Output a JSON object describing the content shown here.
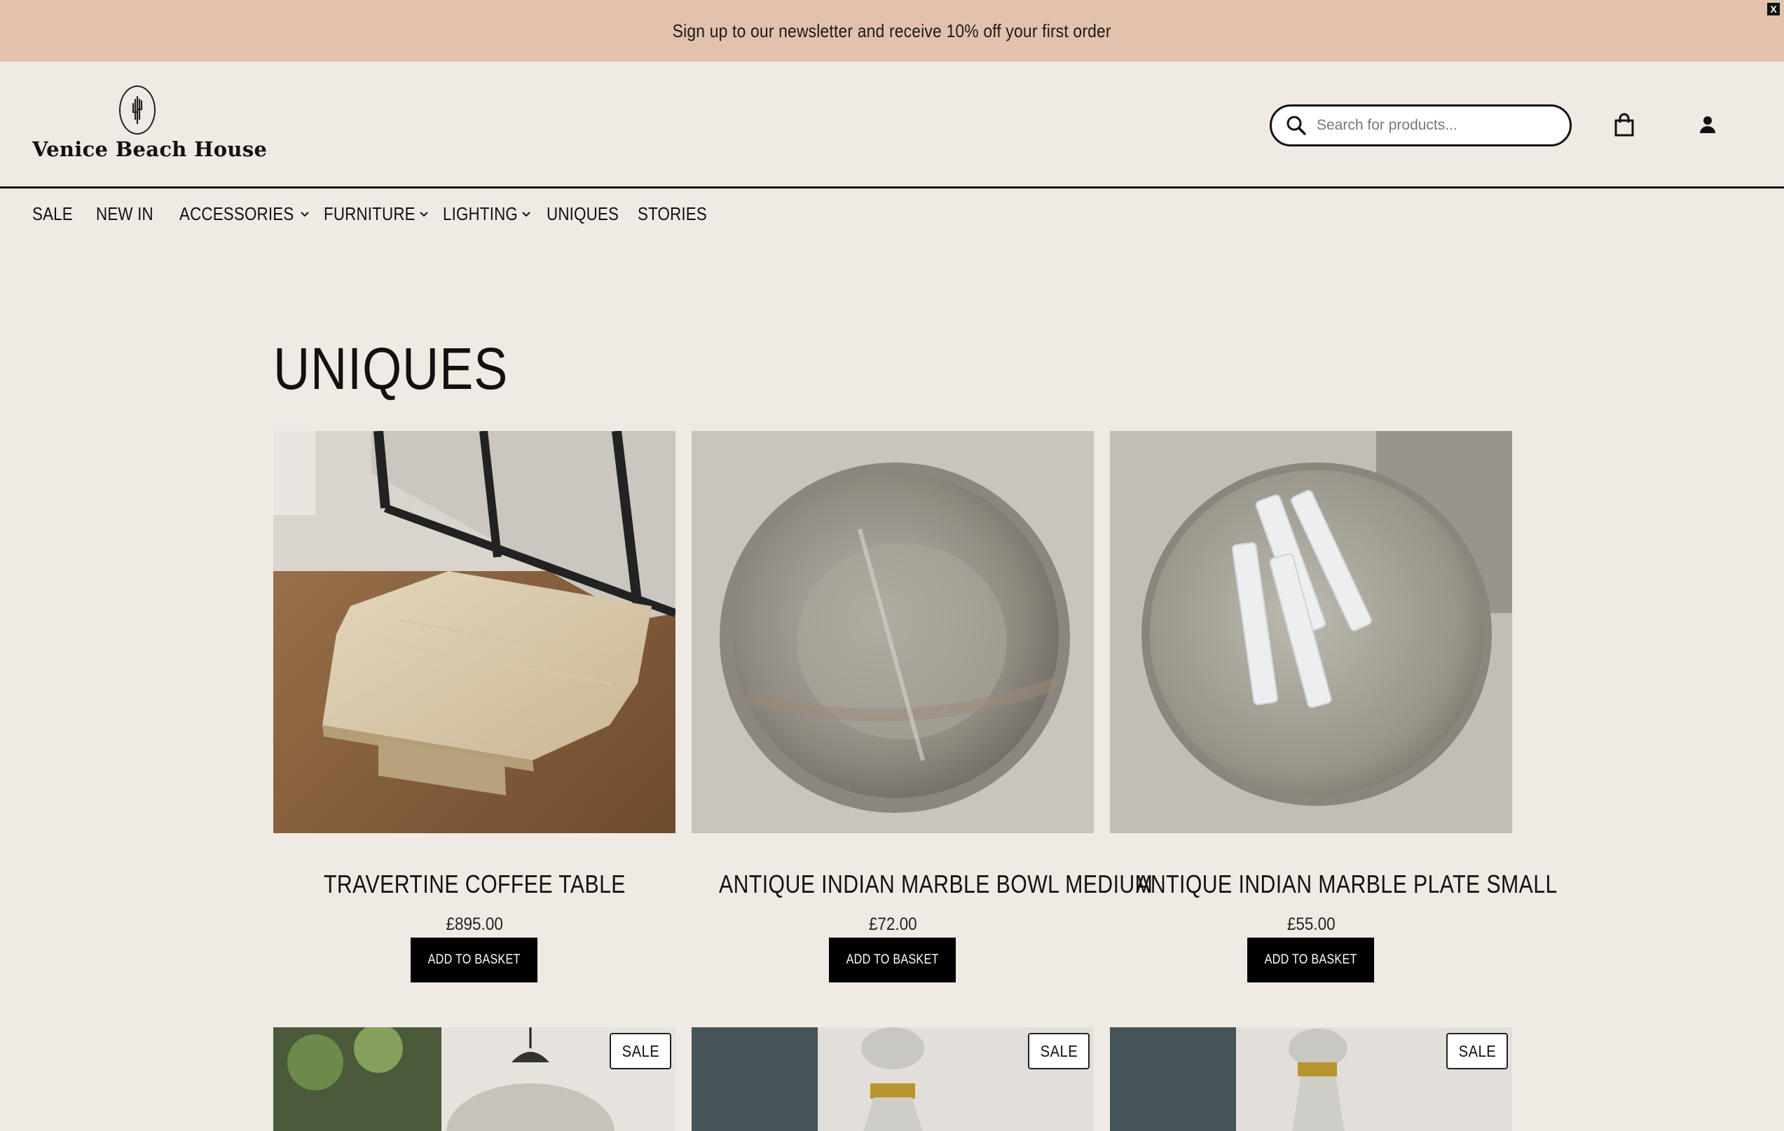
{
  "announcement": {
    "text": "Sign up to our newsletter and receive 10% off your first order",
    "close_label": "X"
  },
  "header": {
    "logo_text": "Venice Beach House",
    "search_placeholder": "Search for products...",
    "search_icon": "search-icon",
    "basket_icon": "basket-icon",
    "account_icon": "account-icon"
  },
  "nav": {
    "items": [
      {
        "label": "SALE",
        "dropdown": false
      },
      {
        "label": "NEW IN",
        "dropdown": false
      },
      {
        "label": "ACCESSORIES",
        "dropdown": true
      },
      {
        "label": "FURNITURE",
        "dropdown": true
      },
      {
        "label": "LIGHTING",
        "dropdown": true
      },
      {
        "label": "UNIQUES",
        "dropdown": false
      },
      {
        "label": "STORIES",
        "dropdown": false
      }
    ]
  },
  "page": {
    "title": "UNIQUES"
  },
  "products": [
    {
      "name": "TRAVERTINE COFFEE TABLE",
      "price": "£895.00",
      "button": "ADD TO BASKET"
    },
    {
      "name": "ANTIQUE INDIAN MARBLE BOWL MEDIUM",
      "price": "£72.00",
      "button": "ADD TO BASKET"
    },
    {
      "name": "ANTIQUE INDIAN MARBLE PLATE SMALL",
      "price": "£55.00",
      "button": "ADD TO BASKET"
    }
  ],
  "products_row2": [
    {
      "badge": "SALE"
    },
    {
      "badge": "SALE"
    },
    {
      "badge": "SALE"
    }
  ],
  "colors": {
    "announcement_bg": "#e2c2ad",
    "page_bg": "#efebe4",
    "button_bg": "#000000"
  }
}
